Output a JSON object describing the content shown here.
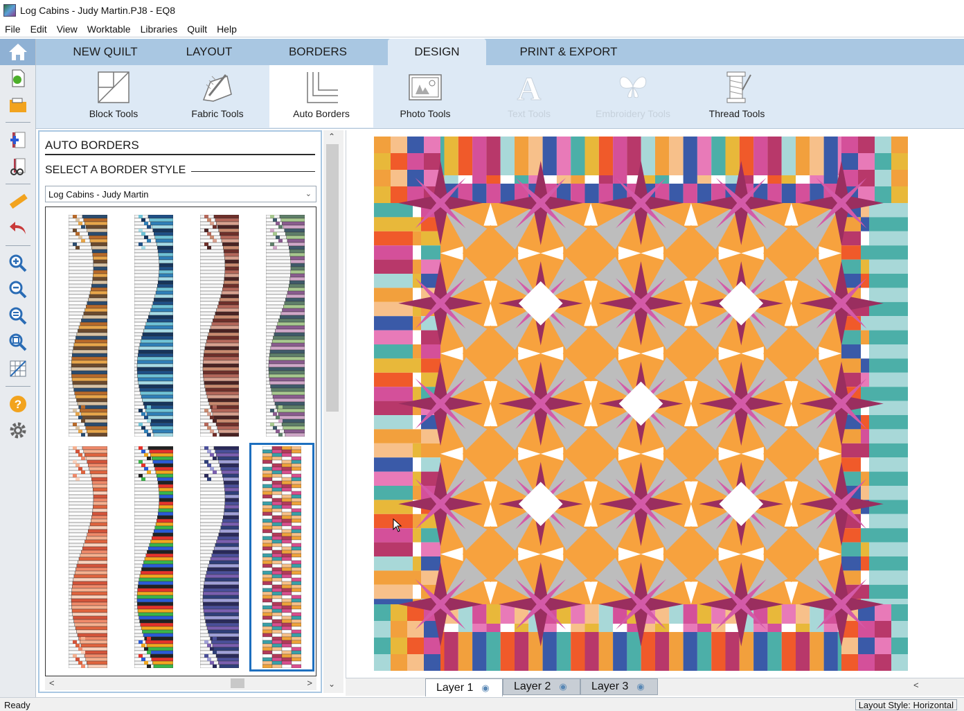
{
  "window": {
    "title": "Log Cabins - Judy Martin.PJ8 - EQ8"
  },
  "menu": [
    "File",
    "Edit",
    "View",
    "Worktable",
    "Libraries",
    "Quilt",
    "Help"
  ],
  "tabs": [
    {
      "label": "NEW QUILT",
      "active": false
    },
    {
      "label": "LAYOUT",
      "active": false
    },
    {
      "label": "BORDERS",
      "active": false
    },
    {
      "label": "DESIGN",
      "active": true
    },
    {
      "label": "PRINT & EXPORT",
      "active": false
    }
  ],
  "ribbon": [
    {
      "label": "Block Tools",
      "icon": "block-tools-icon",
      "state": "normal"
    },
    {
      "label": "Fabric Tools",
      "icon": "fabric-tools-icon",
      "state": "normal"
    },
    {
      "label": "Auto Borders",
      "icon": "auto-borders-icon",
      "state": "active"
    },
    {
      "label": "Photo Tools",
      "icon": "photo-tools-icon",
      "state": "normal"
    },
    {
      "label": "Text Tools",
      "icon": "text-tools-icon",
      "state": "disabled"
    },
    {
      "label": "Embroidery Tools",
      "icon": "embroidery-tools-icon",
      "state": "disabled"
    },
    {
      "label": "Thread Tools",
      "icon": "thread-tools-icon",
      "state": "normal"
    }
  ],
  "left_tools": [
    "home-icon",
    "new-project-icon",
    "open-project-icon",
    "add-to-sketchbook-icon",
    "view-sketchbook-icon",
    "measure-icon",
    "undo-icon",
    "zoom-in-icon",
    "zoom-out-icon",
    "zoom-previous-icon",
    "fit-to-worktable-icon",
    "grid-icon",
    "help-icon",
    "settings-icon"
  ],
  "panel": {
    "title": "AUTO BORDERS",
    "subtitle": "SELECT A BORDER STYLE",
    "dropdown_value": "Log Cabins - Judy Martin",
    "thumbnails": [
      {
        "palette": [
          "#2b4c6f",
          "#b86a2a",
          "#e8a64a",
          "#6b4a2e",
          "#d9c3a5"
        ],
        "selected": false
      },
      {
        "palette": [
          "#1e4f86",
          "#6fc3d7",
          "#2f7fb8",
          "#a6dbe6",
          "#16355c"
        ],
        "selected": false
      },
      {
        "palette": [
          "#6e2f2a",
          "#b4675a",
          "#d8a18f",
          "#4a2323",
          "#c98a6f"
        ],
        "selected": false
      },
      {
        "palette": [
          "#5f7f6a",
          "#a7c88f",
          "#8a5c8f",
          "#d0a7c8",
          "#3f5a6a"
        ],
        "selected": false
      },
      {
        "palette": [
          "#f08a6a",
          "#f6b08f",
          "#e0643e",
          "#fbd1bc",
          "#d4543a"
        ],
        "selected": false
      },
      {
        "palette": [
          "#222222",
          "#e6332a",
          "#f2a81f",
          "#3ab54a",
          "#2a5bd7"
        ],
        "selected": false
      },
      {
        "palette": [
          "#2a2a5a",
          "#4a4f9a",
          "#7a5fb0",
          "#2f3f7a",
          "#a0a0d8"
        ],
        "selected": false
      },
      {
        "palette": [
          "#d94f8e",
          "#f0a33a",
          "#3aa0a8",
          "#b23a5a",
          "#f7c08a"
        ],
        "selected": true
      }
    ]
  },
  "quilt": {
    "border_colors": [
      "#f2a03d",
      "#d4509a",
      "#4cafa8",
      "#f7c08a",
      "#b8386a",
      "#e8b83a",
      "#3a5aa8",
      "#a8d8d8",
      "#f05a2a",
      "#e87ab8"
    ],
    "center": {
      "orange": "#f7a23e",
      "magenta": "#b0417e",
      "pink": "#d45aa8",
      "grey": "#bdbdbd",
      "white": "#ffffff",
      "dark": "#9a2e5f"
    }
  },
  "layers": [
    {
      "label": "Layer 1",
      "active": true
    },
    {
      "label": "Layer 2",
      "active": false
    },
    {
      "label": "Layer 3",
      "active": false
    }
  ],
  "status": {
    "left": "Ready",
    "right": "Layout Style: Horizontal"
  }
}
